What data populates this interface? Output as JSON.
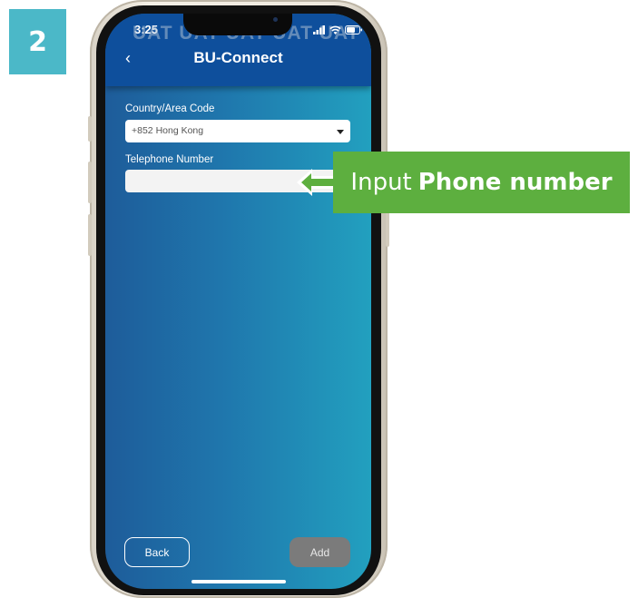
{
  "step": {
    "number": "2"
  },
  "status_bar": {
    "time": "3:25",
    "watermark": "UAT UAT UAT UAT UAT"
  },
  "header": {
    "title": "BU-Connect"
  },
  "form": {
    "country_label": "Country/Area Code",
    "country_value": "+852 Hong Kong",
    "phone_label": "Telephone Number",
    "phone_value": ""
  },
  "footer": {
    "back_label": "Back",
    "add_label": "Add"
  },
  "callout": {
    "prefix": "Input",
    "emphasis": "Phone number"
  },
  "icons": [
    "back-chevron-icon",
    "signal-icon",
    "wifi-icon",
    "battery-icon",
    "dropdown-caret-icon",
    "callout-arrow-icon"
  ],
  "colors": {
    "header": "#0e4f9c",
    "screen_gradient": [
      "#1e5c9a",
      "#22a0bf"
    ],
    "callout": "#5daf3f",
    "step_badge": "#4bb8c8",
    "add_button": "#7b7b7b"
  }
}
